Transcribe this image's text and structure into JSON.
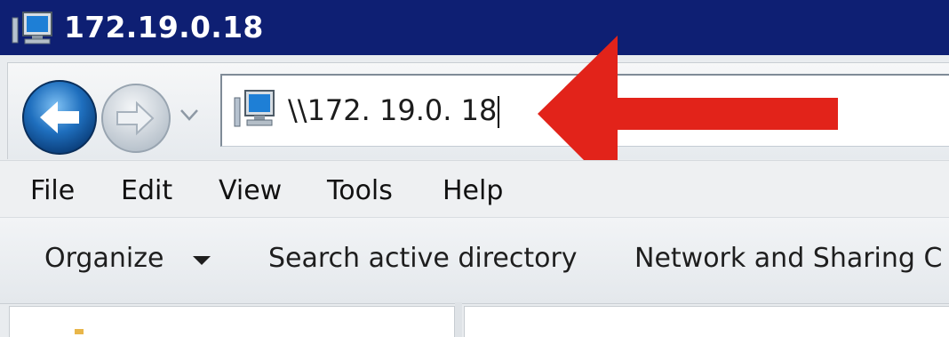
{
  "window": {
    "title": "172.19.0.18"
  },
  "address_bar": {
    "value": "\\\\172. 19.0. 18",
    "icon": "network-computer-icon"
  },
  "navigation": {
    "back_icon": "back-arrow-icon",
    "forward_icon": "forward-arrow-icon",
    "history_icon": "chevron-down-icon"
  },
  "menu": {
    "items": [
      "File",
      "Edit",
      "View",
      "Tools",
      "Help"
    ]
  },
  "command_bar": {
    "organize": "Organize",
    "search_ad": "Search active directory",
    "network_sharing": "Network and Sharing C"
  },
  "annotation": {
    "arrow_color": "#e2231a",
    "direction": "left"
  },
  "colors": {
    "title_bar": "#0e1f73",
    "back_button": "#1f6fbe",
    "forward_button": "#c9d1d9"
  }
}
